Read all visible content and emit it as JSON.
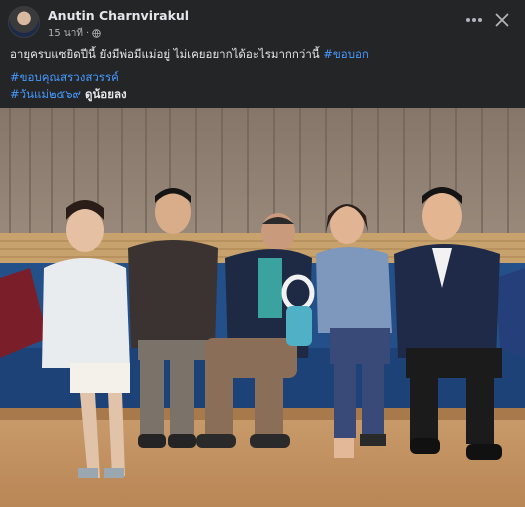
{
  "post": {
    "author": "Anutin Charnvirakul",
    "time": "15 นาที",
    "separator": "·",
    "privacy_icon": "globe-icon",
    "more_icon": "more-options-icon",
    "close_icon": "close-icon",
    "caption_text": "อายุครบแซยิดปีนี้ ยังมีพ่อมีแม่อยู่ ไม่เคยอยากได้อะไรมากกว่านี้ ",
    "caption_tag": "#ขอบอก",
    "tag2": "#ขอบคุณสรวงสวรรค์",
    "tag3": "#วันแม่๒๕๖๙",
    "tag3_suffix": " ดูน้อยลง"
  },
  "colors": {
    "background": "#242526",
    "link": "#4599ff",
    "text": "#e4e6eb",
    "secondary": "#b0b3b8"
  }
}
